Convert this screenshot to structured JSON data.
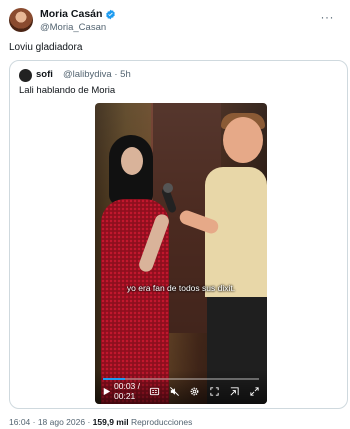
{
  "author": {
    "name": "Moria Casán",
    "handle": "@Moria_Casan",
    "verified": true,
    "more_label": "···"
  },
  "tweet": {
    "text": "Loviu gladiadora"
  },
  "quote": {
    "name": "sofi",
    "handle_time": "@lalibydiva · 5h",
    "text": "Lali hablando de Moria",
    "video": {
      "subtitle": "yo era fan de todos sus dixit.",
      "time": "00:03 / 00:21",
      "progress": 0.14
    }
  },
  "footer": {
    "datetime": "16:04 · 18 ago 2026 · ",
    "views_count": "159,9 mil",
    "views_label": " Reproducciones"
  },
  "colors": {
    "accent": "#1d9bf0",
    "secondary_text": "#536471",
    "border": "#cfd9de"
  },
  "icons": [
    "verified-badge-icon",
    "more-icon",
    "play-icon",
    "closed-captions-icon",
    "mute-icon",
    "settings-icon",
    "fullscreen-icon",
    "pop-out-icon",
    "expand-icon"
  ]
}
